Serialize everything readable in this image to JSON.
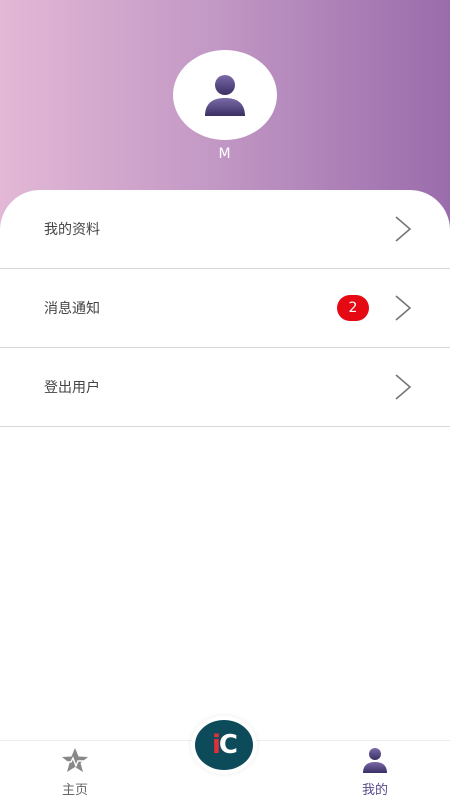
{
  "profile": {
    "username": "M"
  },
  "menu": {
    "items": [
      {
        "label": "我的资料"
      },
      {
        "label": "消息通知",
        "badge": "2"
      },
      {
        "label": "登出用户"
      }
    ]
  },
  "tabbar": {
    "home_label": "主页",
    "center_logo": "iC",
    "mine_label": "我的"
  },
  "colors": {
    "gradient_start": "#e3b8d6",
    "gradient_end": "#9a6cab",
    "accent": "#5a4a8c",
    "badge": "#e50914",
    "logo_bg": "#0d4a5a"
  }
}
